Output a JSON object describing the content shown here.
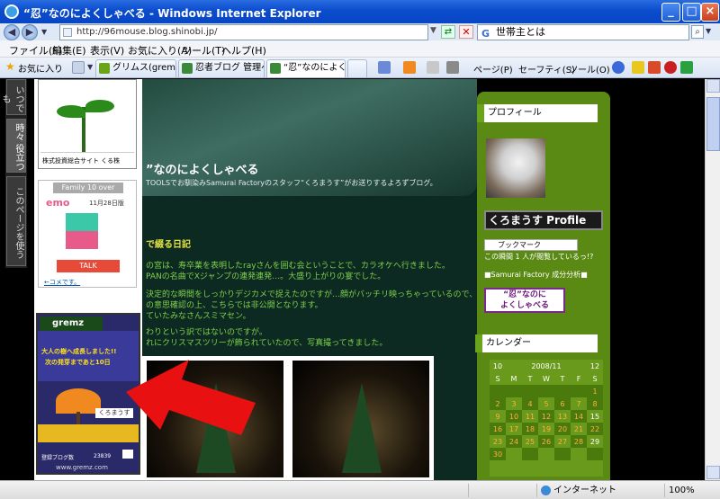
{
  "window": {
    "title": "“忍”なのによくしゃべる - Windows Internet Explorer"
  },
  "address": {
    "url": "http://96mouse.blog.shinobi.jp/",
    "search_value": "世帯主とは"
  },
  "menu": [
    "ファイル(F)",
    "編集(E)",
    "表示(V)",
    "お気に入り(A)",
    "ツール(T)",
    "ヘルプ(H)"
  ],
  "tabs": {
    "favorites": "お気に入り",
    "items": [
      "グリムス(gremz) ...",
      "忍者ブログ 管理ペ...",
      "“忍”なのによく..."
    ]
  },
  "toolbar": {
    "page": "ページ(P)",
    "safety": "セーフティ(S)",
    "tools": "ツール(O)"
  },
  "left_tabs": [
    "いつでも",
    "時々 役立つ",
    "このページを使う"
  ],
  "left": {
    "kurukabu": "株式投資総合サイト くる株",
    "family": "Family 10 over",
    "emo_date": "11月28日版",
    "talk": "TALK",
    "link": "←コメです。",
    "gremz_logo": "gremz",
    "gremz_msg1": "大人の樹へ成長しました!!",
    "gremz_msg2": "次の発芽まであと10日",
    "gremz_name": "くろまうす",
    "gremz_count_label": "登録ブログ数",
    "gremz_count": "23839",
    "gremz_url": "www.gremz.com"
  },
  "blog": {
    "title": "”なのによくしゃべる",
    "subtitle": "TOOLSでお馴染みSamurai Factoryのスタッフ“くろまうす”がお送りするよろずブログ。",
    "section": "で綴る日記",
    "para": [
      "の宮は、寿卒業を表明したrayさんを囲む会ということで、カラオケへ行きました。",
      "PANの名曲でXジャンプの連発連発…。大盛り上がりの宴でした。",
      "決定的な瞬間をしっかりデジカメで捉えたのですが…顔がバッチリ映っちゃっているので、本",
      "の意思確認の上、こちらでは非公開となります。",
      "ていたみなさんスミマセン。",
      "わりという訳ではないのですが。",
      "れにクリスマスツリーが飾られていたので、写真撮ってきました。"
    ]
  },
  "right": {
    "profile_h": "プロフィール",
    "profile_name": "くろまうす Profile",
    "bookmark": "ブックマーク",
    "readers": "この瞬間 1 人が閲覧しているっ!?",
    "analysis": "■Samurai Factory 成分分析■",
    "banner1": "“忍”なのに",
    "banner2": "よくしゃべる",
    "calendar_h": "カレンダー",
    "cal_prev": "10",
    "cal_month": "2008/11",
    "cal_next": "12",
    "days": [
      "S",
      "M",
      "T",
      "W",
      "T",
      "F",
      "S"
    ],
    "weeks": [
      [
        "",
        "",
        "",
        "",
        "",
        "",
        "1"
      ],
      [
        "2",
        "3",
        "4",
        "5",
        "6",
        "7",
        "8"
      ],
      [
        "9",
        "10",
        "11",
        "12",
        "13",
        "14",
        "15"
      ],
      [
        "16",
        "17",
        "18",
        "19",
        "20",
        "21",
        "22"
      ],
      [
        "23",
        "24",
        "25",
        "26",
        "27",
        "28",
        "29"
      ],
      [
        "30",
        "",
        "",
        "",
        "",
        "",
        ""
      ]
    ]
  },
  "status": {
    "zone": "インターネット",
    "zoom": "100%"
  }
}
